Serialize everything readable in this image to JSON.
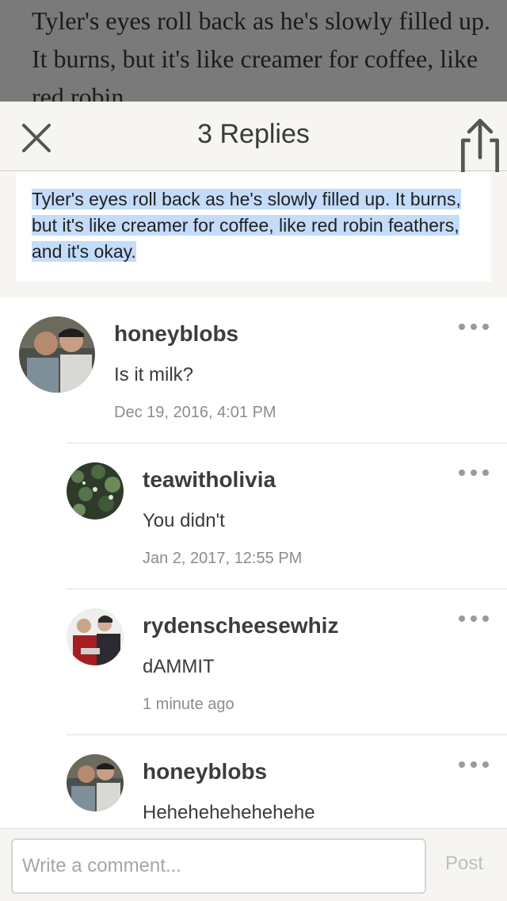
{
  "story_background": {
    "text": "Tyler's eyes roll back as he's slowly filled up. It burns, but it's like creamer for coffee, like red robin"
  },
  "header": {
    "title": "3 Replies",
    "close_icon": "close-icon",
    "share_icon": "share-icon"
  },
  "quote": {
    "text": "Tyler's eyes roll back as he's slowly filled up. It burns, but it's like creamer for coffee, like red robin feathers, and it's okay.",
    "highlight_color": "#c3dcfa"
  },
  "comments": [
    {
      "username": "honeyblobs",
      "text": "Is it milk?",
      "timestamp": "Dec 19, 2016, 4:01 PM",
      "is_reply": false
    },
    {
      "username": "teawitholivia",
      "text": "You didn't",
      "timestamp": "Jan 2, 2017, 12:55 PM",
      "is_reply": true
    },
    {
      "username": "rydenscheesewhiz",
      "text": "dAMMIT",
      "timestamp": "1 minute ago",
      "is_reply": true
    },
    {
      "username": "honeyblobs",
      "text": "Hehehehehehehehe",
      "timestamp": "",
      "is_reply": true
    }
  ],
  "composer": {
    "placeholder": "Write a comment...",
    "post_label": "Post"
  },
  "colors": {
    "header_bg": "#f6f5f1",
    "dim_overlay": "#7a7a7a",
    "post_disabled": "#bdbdbd"
  }
}
